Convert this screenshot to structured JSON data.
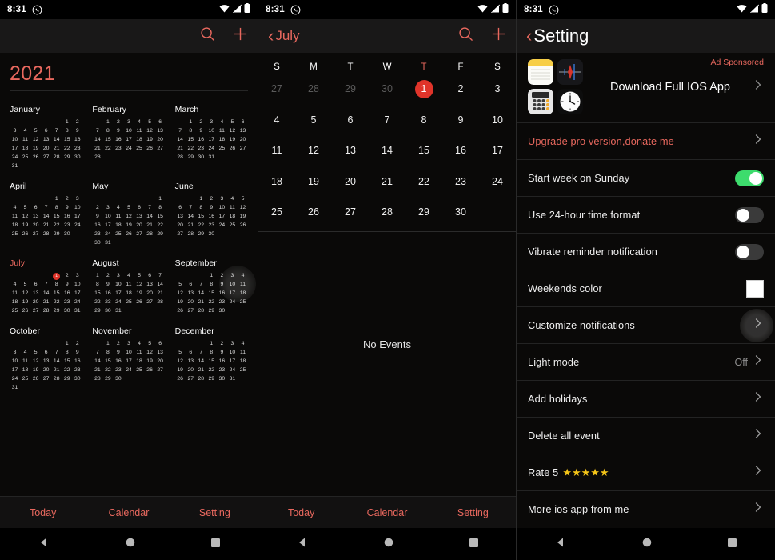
{
  "statusbar": {
    "time": "8:31",
    "icons": [
      "whatsapp-icon",
      "wifi-icon",
      "signal-off-icon",
      "battery-icon"
    ]
  },
  "colors": {
    "accent": "#e8685e",
    "today": "#e0342a",
    "toggle_on": "#3ddc6d",
    "star": "#f5c518",
    "background": "#0a0908"
  },
  "year_view": {
    "toolbar": {
      "search_label": "search-icon",
      "add_label": "add-icon"
    },
    "year": "2021",
    "current_month": "July",
    "today_day": 1,
    "months": [
      {
        "name": "January",
        "lead": 5,
        "days": 31
      },
      {
        "name": "February",
        "lead": 1,
        "days": 28
      },
      {
        "name": "March",
        "lead": 1,
        "days": 31
      },
      {
        "name": "April",
        "lead": 4,
        "days": 30
      },
      {
        "name": "May",
        "lead": 6,
        "days": 31
      },
      {
        "name": "June",
        "lead": 2,
        "days": 30
      },
      {
        "name": "July",
        "lead": 4,
        "days": 31
      },
      {
        "name": "August",
        "lead": 0,
        "days": 31
      },
      {
        "name": "September",
        "lead": 3,
        "days": 30
      },
      {
        "name": "October",
        "lead": 5,
        "days": 31
      },
      {
        "name": "November",
        "lead": 1,
        "days": 30
      },
      {
        "name": "December",
        "lead": 3,
        "days": 31
      }
    ]
  },
  "month_view": {
    "toolbar": {
      "back_label": "‹",
      "title": "July"
    },
    "weekdays": [
      "S",
      "M",
      "T",
      "W",
      "T",
      "F",
      "S"
    ],
    "highlight_weekday_index": 4,
    "leading_days": [
      27,
      28,
      29,
      30
    ],
    "days": [
      1,
      2,
      3,
      4,
      5,
      6,
      7,
      8,
      9,
      10,
      11,
      12,
      13,
      14,
      15,
      16,
      17,
      18,
      19,
      20,
      21,
      22,
      23,
      24,
      25,
      26,
      27,
      28,
      29,
      30
    ],
    "selected_day": 1,
    "events_empty_text": "No Events"
  },
  "settings": {
    "toolbar": {
      "back_label": "‹",
      "title": "Setting"
    },
    "ad": {
      "sponsored_label": "Ad Sponsored",
      "title": "Download Full IOS App",
      "icons": [
        "notes-app-icon",
        "voice-memos-app-icon",
        "calculator-app-icon",
        "clock-app-icon"
      ]
    },
    "rows": [
      {
        "label": "Upgrade pro version,donate me",
        "type": "chevron",
        "red": true
      },
      {
        "label": "Start week on Sunday",
        "type": "toggle",
        "value": "on"
      },
      {
        "label": "Use 24-hour time format",
        "type": "toggle",
        "value": "off"
      },
      {
        "label": "Vibrate reminder notification",
        "type": "toggle",
        "value": "off"
      },
      {
        "label": "Weekends color",
        "type": "swatch",
        "value": "#ffffff"
      },
      {
        "label": "Customize notifications",
        "type": "chevron",
        "ripple": true
      },
      {
        "label": "Light mode",
        "type": "chevron",
        "value": "Off"
      },
      {
        "label": "Add holidays",
        "type": "chevron"
      },
      {
        "label": "Delete all event",
        "type": "chevron"
      },
      {
        "label": "Rate 5",
        "type": "chevron",
        "stars": "★★★★★"
      },
      {
        "label": "More ios app from me",
        "type": "chevron"
      }
    ]
  },
  "tabbar": {
    "items": [
      "Today",
      "Calendar",
      "Setting"
    ]
  },
  "navbar": {
    "items": [
      "back-nav-icon",
      "home-nav-icon",
      "recents-nav-icon"
    ]
  }
}
